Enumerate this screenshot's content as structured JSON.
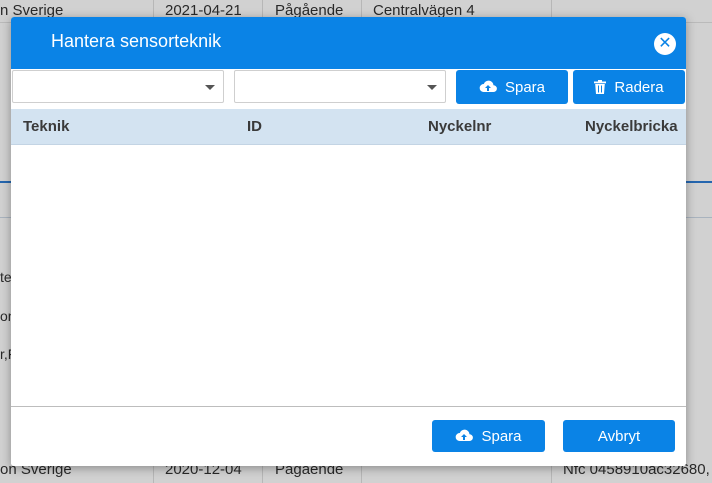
{
  "background": {
    "top_row": {
      "col1": "n Sverige",
      "col2": "2021-04-21",
      "col3": "Pågående",
      "col4": "Centralvägen 4"
    },
    "bottom_row": {
      "col1": "on Sverige",
      "col2": "2020-12-04",
      "col3": "Pågående",
      "col4": "Nfc 0458910ac32680,"
    },
    "fragments": [
      "te",
      "on",
      "r,F"
    ]
  },
  "modal": {
    "title": "Hantera sensorteknik",
    "close_icon": "close-icon",
    "toolbar": {
      "select1_value": "",
      "select2_value": "",
      "save_label": "Spara",
      "delete_label": "Radera"
    },
    "grid": {
      "columns": [
        "Teknik",
        "ID",
        "Nyckelnr",
        "Nyckelbricka"
      ],
      "rows": []
    },
    "footer": {
      "save_label": "Spara",
      "cancel_label": "Avbryt"
    }
  },
  "colors": {
    "accent": "#0a83e6",
    "grid_header": "#d3e3f1"
  }
}
